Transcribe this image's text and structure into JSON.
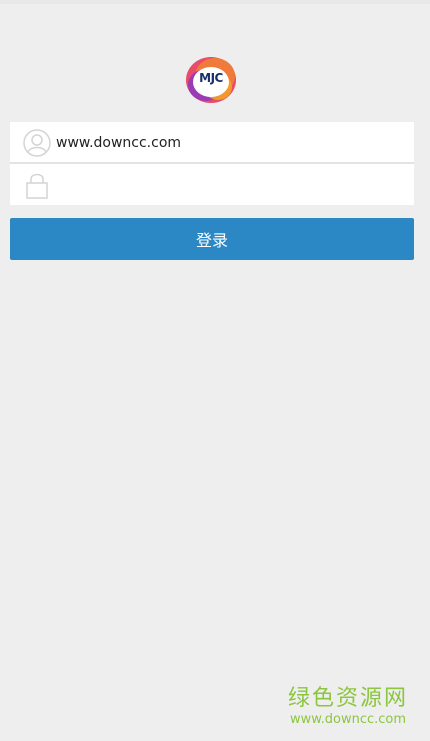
{
  "app": {
    "logo_text": "MJC"
  },
  "login": {
    "username_value": "www.downcc.com",
    "password_value": "",
    "submit_label": "登录"
  },
  "icons": {
    "username": "user-icon",
    "password": "lock-icon"
  },
  "colors": {
    "background": "#eeeeee",
    "field_background": "#ffffff",
    "button_primary": "#2b88c4",
    "button_text": "#ffffff",
    "watermark": "#8cc63f"
  },
  "watermark": {
    "title": "绿色资源网",
    "url": "www.downcc.com"
  }
}
